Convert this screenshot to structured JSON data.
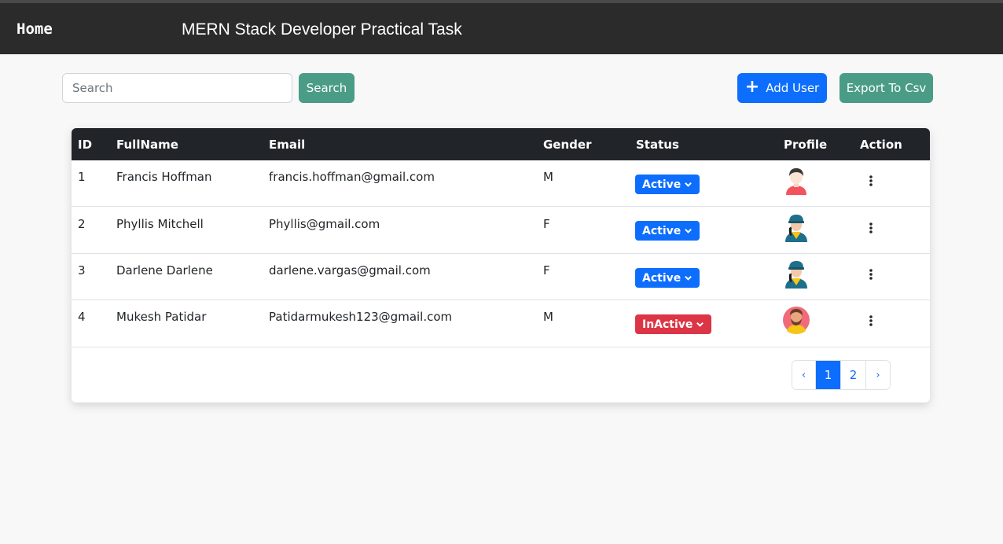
{
  "nav": {
    "home": "Home",
    "title": "MERN Stack Developer Practical Task"
  },
  "toolbar": {
    "search_placeholder": "Search",
    "search_value": "",
    "search_label": "Search",
    "add_label": "Add User",
    "export_label": "Export To Csv"
  },
  "table": {
    "headers": {
      "id": "ID",
      "fullname": "FullName",
      "email": "Email",
      "gender": "Gender",
      "status": "Status",
      "profile": "Profile",
      "action": "Action"
    },
    "rows": [
      {
        "id": "1",
        "name": "Francis Hoffman",
        "email": "francis.hoffman@gmail.com",
        "gender": "M",
        "status": "Active",
        "avatar": "male-avatar-icon"
      },
      {
        "id": "2",
        "name": "Phyllis Mitchell",
        "email": "Phyllis@gmail.com",
        "gender": "F",
        "status": "Active",
        "avatar": "female-worker-avatar-icon"
      },
      {
        "id": "3",
        "name": "Darlene Darlene",
        "email": "darlene.vargas@gmail.com",
        "gender": "F",
        "status": "Active",
        "avatar": "female-worker-avatar-icon"
      },
      {
        "id": "4",
        "name": "Mukesh Patidar",
        "email": "Patidarmukesh123@gmail.com",
        "gender": "M",
        "status": "InActive",
        "avatar": "bearded-man-avatar-icon"
      }
    ]
  },
  "pagination": {
    "prev": "‹",
    "pages": [
      "1",
      "2"
    ],
    "current": "1",
    "next": "›"
  },
  "colors": {
    "navbar": "#2b2b2b",
    "primary": "#0d6efd",
    "teal": "#4a9c86",
    "danger": "#dc3545",
    "table_head": "#212529"
  }
}
